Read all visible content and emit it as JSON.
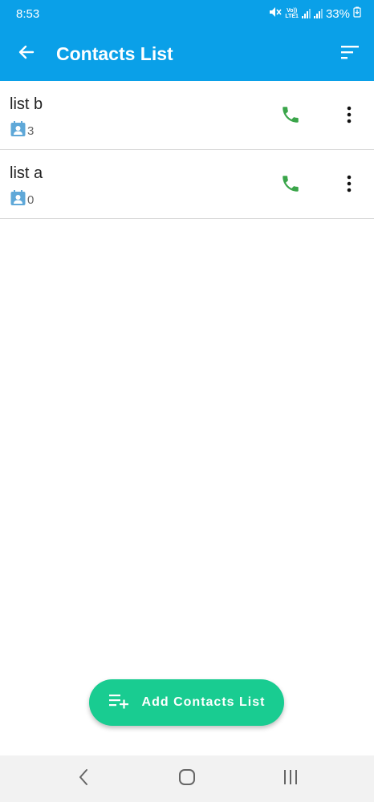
{
  "status_bar": {
    "time": "8:53",
    "battery": "33%",
    "volte_top": "Vo))",
    "volte_bottom": "LTE1",
    "icons": [
      "mute-icon",
      "volte-icon",
      "signal-icon",
      "signal-icon",
      "battery-icon"
    ]
  },
  "app_bar": {
    "title": "Contacts List",
    "back_icon": "arrow-back-icon",
    "sort_icon": "sort-icon"
  },
  "lists": [
    {
      "name": "list b",
      "count": "3"
    },
    {
      "name": "list a",
      "count": "0"
    }
  ],
  "fab": {
    "label": "Add Contacts List",
    "icon": "playlist-add-icon"
  },
  "nav": {
    "icons": [
      "nav-back-icon",
      "nav-home-icon",
      "nav-recents-icon"
    ]
  },
  "colors": {
    "primary": "#0aa0e8",
    "accent": "#19cc91",
    "call": "#3aa54a",
    "badge": "#5fa8d8"
  }
}
